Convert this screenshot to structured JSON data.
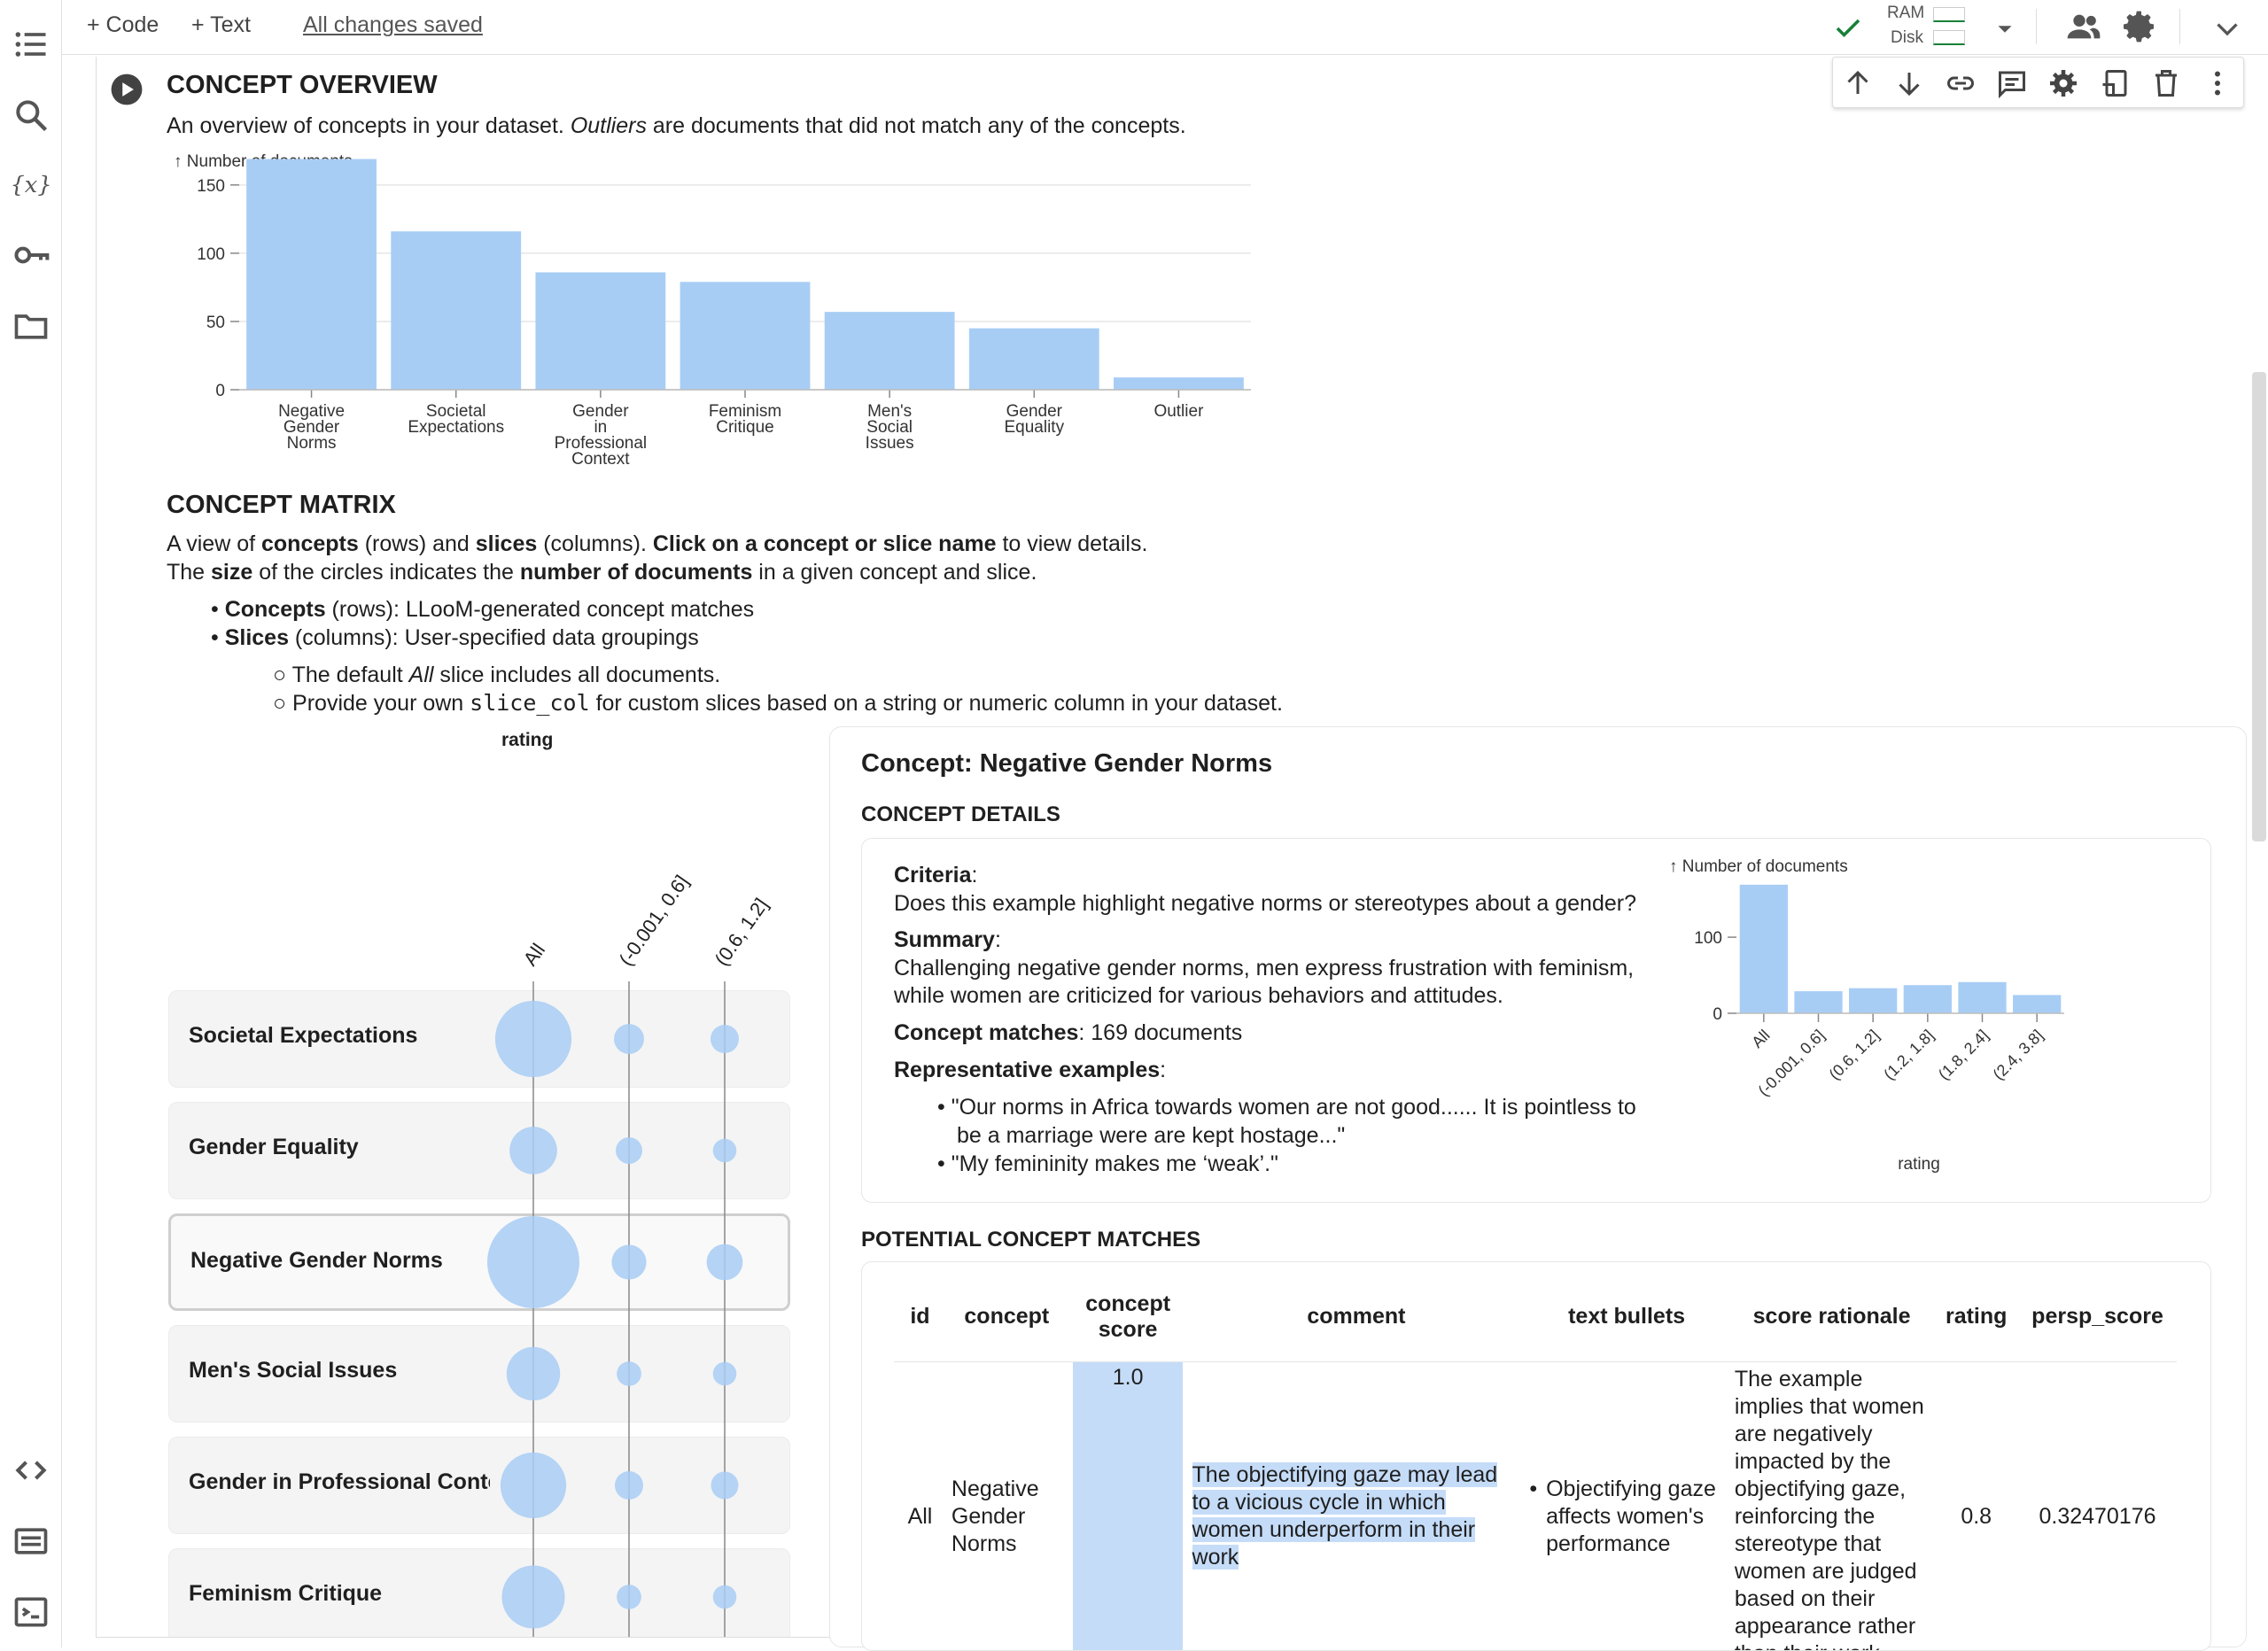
{
  "toolbar": {
    "code_label": "+ Code",
    "text_label": "+ Text",
    "save_status": "All changes saved",
    "ram_label": "RAM",
    "disk_label": "Disk"
  },
  "sidebar": {
    "icons": [
      "table-of-contents-icon",
      "search-icon",
      "variables-icon",
      "secrets-key-icon",
      "folder-icon",
      "code-snippets-icon",
      "command-palette-icon",
      "terminal-icon"
    ]
  },
  "overview": {
    "title": "CONCEPT OVERVIEW",
    "desc_prefix": "An overview of concepts in your dataset.",
    "desc_italic": "Outliers",
    "desc_suffix": "are documents that did not match any of the concepts.",
    "chart_data": {
      "type": "bar",
      "ylabel": "↑ Number of documents",
      "categories": [
        "Negative Gender Norms",
        "Societal Expectations",
        "Gender in Professional Context",
        "Feminism Critique",
        "Men's Social Issues",
        "Gender Equality",
        "Outlier"
      ],
      "values": [
        169,
        116,
        86,
        79,
        57,
        45,
        9
      ],
      "yticks": [
        0,
        50,
        100,
        150
      ],
      "ylim": [
        0,
        170
      ],
      "color": "#a8cdf5"
    }
  },
  "matrix": {
    "title": "CONCEPT MATRIX",
    "line1": [
      "A view of ",
      "concepts",
      " (rows) and ",
      "slices",
      " (columns). ",
      "Click on a concept or slice name",
      " to view details."
    ],
    "line2": [
      "The ",
      "size",
      " of the circles indicates the ",
      "number of documents",
      " in a given concept and slice."
    ],
    "b1": [
      "Concepts",
      " (rows): LLooM-generated concept matches"
    ],
    "b2": [
      "Slices",
      " (columns): User-specified data groupings"
    ],
    "sb1": [
      "The default ",
      "All",
      " slice includes all documents."
    ],
    "sb2": [
      "Provide your own ",
      "slice_col",
      " for custom slices based on a string or numeric column in your dataset."
    ],
    "header": "rating",
    "columns": [
      "All",
      "(-0.001, 0.6]",
      "(0.6, 1.2]"
    ],
    "rows": [
      {
        "label": "Societal Expectations",
        "sizes": [
          116,
          18,
          16
        ]
      },
      {
        "label": "Gender Equality",
        "sizes": [
          45,
          14,
          11
        ]
      },
      {
        "label": "Negative Gender Norms",
        "sizes": [
          169,
          24,
          26
        ]
      },
      {
        "label": "Men's Social Issues",
        "sizes": [
          57,
          12,
          11
        ]
      },
      {
        "label": "Gender in Professional Context",
        "sizes": [
          86,
          16,
          15
        ]
      },
      {
        "label": "Feminism Critique",
        "sizes": [
          79,
          12,
          11
        ]
      }
    ],
    "selected": "Negative Gender Norms"
  },
  "detail": {
    "title": "Concept: Negative Gender Norms",
    "details_heading": "CONCEPT DETAILS",
    "criteria_label": "Criteria",
    "criteria": "Does this example highlight negative norms or stereotypes about a gender?",
    "summary_label": "Summary",
    "summary1": "Challenging negative gender norms, men express frustration with feminism,",
    "summary2": "while women are criticized for various behaviors and attitudes.",
    "matches_label": "Concept matches",
    "matches": ": 169 documents",
    "examples_label": "Representative examples",
    "ex1a": "\"Our norms in Africa towards women are not good...... It is pointless to",
    "ex1b": "be a marriage were are kept hostage...\"",
    "ex2": "\"My femininity makes me ‘weak’.\"",
    "chart_data": {
      "type": "bar",
      "ylabel": "↑ Number of documents",
      "xlabel": "rating",
      "categories": [
        "All",
        "(-0.001, 0.6]",
        "(0.6, 1.2]",
        "(1.2, 1.8]",
        "(1.8, 2.4]",
        "(2.4, 3.8]"
      ],
      "values": [
        169,
        29,
        33,
        37,
        41,
        24
      ],
      "yticks": [
        0,
        100
      ],
      "ylim": [
        0,
        170
      ],
      "color": "#a8cdf5"
    }
  },
  "matches": {
    "heading": "POTENTIAL CONCEPT MATCHES",
    "columns": [
      "id",
      "concept",
      "concept score",
      "comment",
      "text bullets",
      "score rationale",
      "rating",
      "persp_score"
    ],
    "row": {
      "id": "All",
      "concept": "Negative Gender Norms",
      "score": "1.0",
      "comment": "The objectifying gaze may lead to a vicious cycle in which women underperform in their work",
      "bullet": "Objectifying gaze affects women's performance",
      "rationale": "The example implies that women are negatively impacted by the objectifying gaze, reinforcing the stereotype that women are judged based on their appearance rather than their work",
      "rating": "0.8",
      "persp": "0.32470176"
    }
  }
}
